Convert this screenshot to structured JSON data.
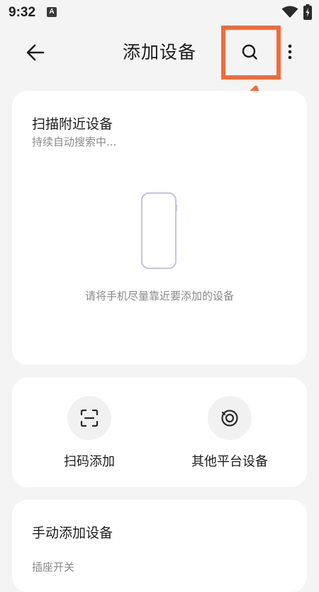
{
  "status_bar": {
    "time": "9:32",
    "notification_badge": "A",
    "icons": [
      "wifi-icon",
      "battery-charging-icon"
    ]
  },
  "app_bar": {
    "title": "添加设备",
    "back_icon": "arrow-left-icon",
    "search_icon": "search-icon",
    "more_icon": "more-vertical-icon"
  },
  "annotation": {
    "highlight_color": "#f26b3a"
  },
  "scan_card": {
    "title": "扫描附近设备",
    "subtitle": "持续自动搜索中...",
    "hint": "请将手机尽量靠近要添加的设备"
  },
  "actions": [
    {
      "label": "扫码添加",
      "icon": "scan-qr-icon"
    },
    {
      "label": "其他平台设备",
      "icon": "other-platform-icon"
    }
  ],
  "manual_card": {
    "title": "手动添加设备",
    "items": [
      "插座开关"
    ]
  },
  "colors": {
    "background": "#f4f4f4",
    "card": "#ffffff",
    "accent": "#f26b3a",
    "secondary_text": "#8a8a8a"
  }
}
